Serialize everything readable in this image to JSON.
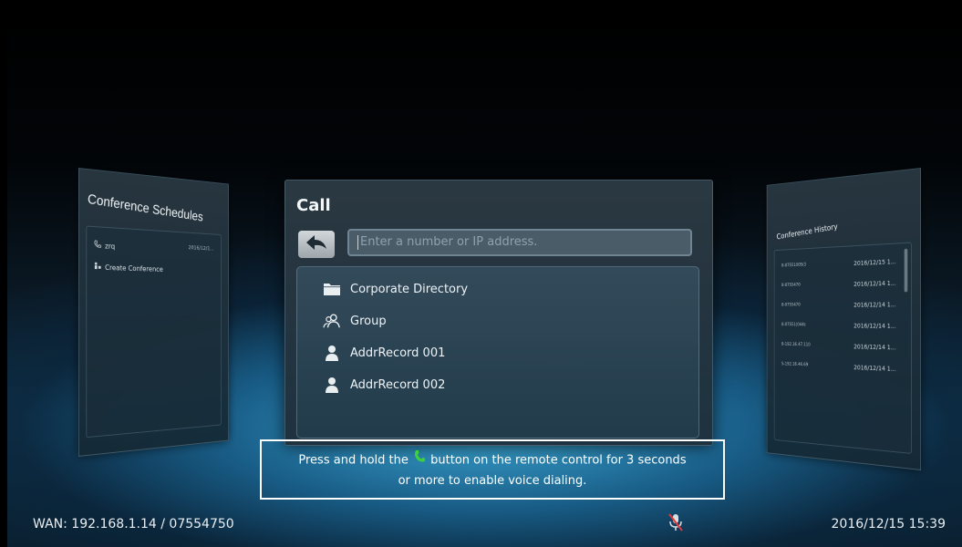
{
  "left_panel": {
    "title": "Conference Schedules",
    "items": [
      {
        "label": "zrq",
        "date": "2016/12/1..."
      },
      {
        "label": "Create Conference"
      }
    ]
  },
  "call_panel": {
    "title": "Call",
    "search": {
      "placeholder": "Enter a number or IP address.",
      "value": ""
    },
    "items": [
      {
        "label": "Corporate Directory",
        "icon": "folder-icon"
      },
      {
        "label": "Group",
        "icon": "group-icon"
      },
      {
        "label": "AddrRecord 001",
        "icon": "person-icon"
      },
      {
        "label": "AddrRecord 002",
        "icon": "person-icon"
      }
    ]
  },
  "right_panel": {
    "title": "Conference History",
    "items": [
      {
        "number": "8-07551005(3",
        "time": "2016/12/15 1..."
      },
      {
        "number": "8-0755470",
        "time": "2016/12/14 1..."
      },
      {
        "number": "8-0755470",
        "time": "2016/12/14 1..."
      },
      {
        "number": "8-07551(044s",
        "time": "2016/12/14 1..."
      },
      {
        "number": "8-192.16.47.110",
        "time": "2016/12/14 1..."
      },
      {
        "number": "S-192.16.46.69",
        "time": "2016/12/14 1..."
      }
    ]
  },
  "hint": {
    "line1_pre": "Press and hold the",
    "line1_post": "button on the remote control for 3 seconds",
    "line2": "or more to enable voice dialing."
  },
  "status": {
    "wan": "WAN: 192.168.1.14 / 07554750",
    "datetime": "2016/12/15 15:39"
  },
  "colors": {
    "accent_green": "#3cd23c",
    "hint_border": "#ffffff",
    "mute_red": "#e03a3a"
  }
}
